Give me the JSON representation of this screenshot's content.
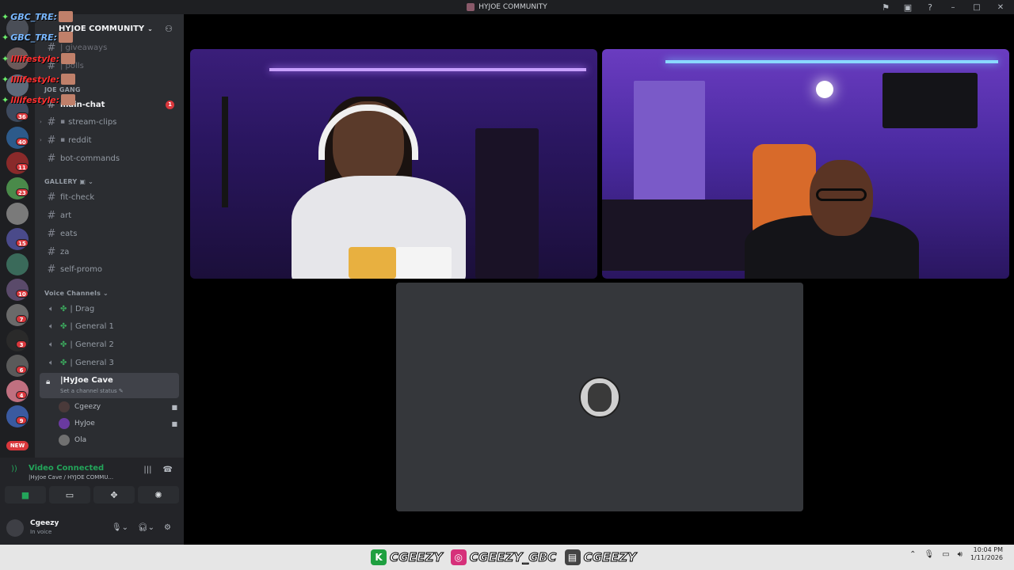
{
  "window": {
    "title": "HYJOE COMMUNITY",
    "controls": [
      "flag-icon",
      "inbox-icon",
      "help-icon",
      "minimize",
      "maximize",
      "close"
    ]
  },
  "overlay_chat": [
    {
      "user": "GBC_TRE:"
    },
    {
      "user": "GBC_TRE:"
    },
    {
      "user": "lllifestyle:"
    },
    {
      "user": "lllifestyle:"
    },
    {
      "user": "lllifestyle:"
    }
  ],
  "server": {
    "name": "HYJOE COMMUNITY",
    "channels_top": [
      {
        "name": "| giveaways"
      },
      {
        "name": "| polls"
      }
    ],
    "category_joe": "JOE GANG",
    "channels_joe": [
      {
        "name": "main-chat",
        "unread": "1"
      },
      {
        "name": "stream-clips"
      },
      {
        "name": "reddit"
      },
      {
        "name": "bot-commands"
      }
    ],
    "category_gallery": "GALLERY",
    "channels_gallery": [
      {
        "name": "fit-check"
      },
      {
        "name": "art"
      },
      {
        "name": "eats"
      },
      {
        "name": "za"
      },
      {
        "name": "self-promo"
      }
    ],
    "category_voice": "Voice Channels",
    "voice_channels": [
      {
        "name": "| Drag"
      },
      {
        "name": "| General 1"
      },
      {
        "name": "| General 2"
      },
      {
        "name": "| General 3"
      }
    ],
    "active_voice": {
      "name": "|HyJoe Cave",
      "status": "Set a channel status"
    },
    "members": [
      {
        "name": "Cgeezy",
        "camera": true
      },
      {
        "name": "HyJoe",
        "camera": true
      },
      {
        "name": "Ola",
        "camera": false
      }
    ]
  },
  "rail_badges": [
    "36",
    "40",
    "11",
    "23",
    "15",
    "10",
    "7",
    "3",
    "6",
    "4",
    "9"
  ],
  "rail_new": "NEW",
  "voice_panel": {
    "status": "Video Connected",
    "sub": "|HyJoe Cave / HYJOE COMMU..."
  },
  "user": {
    "name": "Cgeezy",
    "status": "In voice"
  },
  "taskbar": {
    "handles": [
      "CGEEZY",
      "CGEEZY_GBC",
      "CGEEZY"
    ],
    "time": "10:04 PM",
    "date": "1/11/2026"
  },
  "colors": {
    "green": "#23a55a",
    "red": "#da373c",
    "sidebar": "#2b2d31",
    "rail": "#1e1f22"
  }
}
